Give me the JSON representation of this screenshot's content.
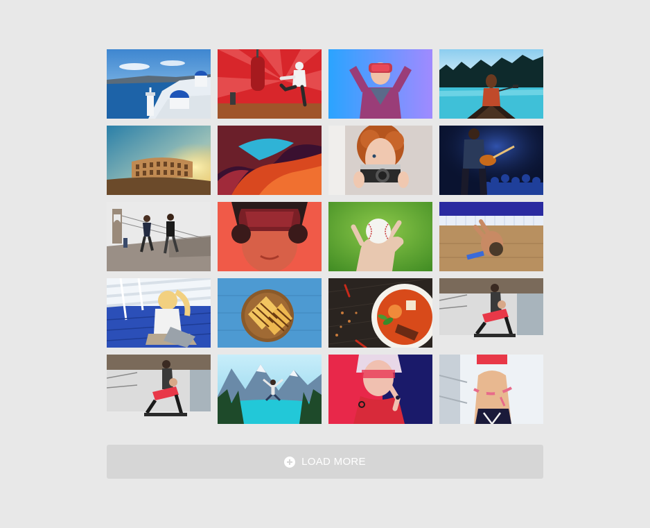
{
  "gallery": {
    "tiles": [
      {
        "subject": "santorini-coast",
        "colors": {
          "sky": "#6fb0e6",
          "sea": "#1d63a8",
          "land": "#e8eef4",
          "accent": "#1e55b8"
        }
      },
      {
        "subject": "boxer-red-room",
        "colors": {
          "bg": "#d8262b",
          "stripe": "#f06a6a",
          "floor": "#a0542a",
          "figure": "#f2f2f2"
        }
      },
      {
        "subject": "woman-vr-headset-blue",
        "colors": {
          "bg": "#3aa8ff",
          "bg2": "#9b7cff",
          "shirt": "#9a3d78",
          "skin": "#f0c2a8"
        }
      },
      {
        "subject": "woman-canoe-lake",
        "colors": {
          "sky": "#a9d9f2",
          "trees": "#0e2a2c",
          "water": "#3fc0d8",
          "boat": "#2b1d16"
        }
      },
      {
        "subject": "colosseum-sunset",
        "colors": {
          "sky": "#3a8fb0",
          "sun": "#ffd36a",
          "ruin": "#c08a52",
          "ground": "#6b4a2a"
        }
      },
      {
        "subject": "antelope-canyon",
        "colors": {
          "rock": "#d9481f",
          "rock2": "#6b1f2a",
          "sky": "#2fb3d6",
          "shadow": "#3a1030"
        }
      },
      {
        "subject": "redhead-camera",
        "colors": {
          "bg": "#d8d0cc",
          "hair": "#b5551e",
          "skin": "#f0c8b0",
          "camera": "#2a2a2a"
        }
      },
      {
        "subject": "guitarist-concert",
        "colors": {
          "bg": "#0a1330",
          "crowd": "#1f3f9a",
          "light": "#4a7cff",
          "guitar": "#c86a1a"
        }
      },
      {
        "subject": "couple-running-bridge",
        "colors": {
          "sky": "#eaeaea",
          "bridge": "#8a8a8a",
          "shirt": "#222a40",
          "road": "#9a8f86"
        }
      },
      {
        "subject": "woman-vr-headset-red",
        "colors": {
          "bg": "#f05a48",
          "headset": "#7a1f26",
          "skin": "#d86048",
          "hair": "#2a1a1a"
        }
      },
      {
        "subject": "hand-holding-baseball",
        "colors": {
          "bg": "#4e9a2a",
          "bg2": "#8cc84a",
          "skin": "#e8c8b0",
          "ball": "#f4f4f0"
        }
      },
      {
        "subject": "boy-at-pool",
        "colors": {
          "water": "#2a2aa0",
          "tile": "#e8eef8",
          "deck": "#b89060",
          "skin": "#c88a64"
        }
      },
      {
        "subject": "woman-laptop-deck",
        "colors": {
          "bg": "#2b4fb8",
          "rail": "#e8eef4",
          "hair": "#f2d080",
          "shirt": "#f2f2f2"
        }
      },
      {
        "subject": "grilled-sandwich",
        "colors": {
          "bg": "#4d9ad2",
          "plate": "#8a5a2a",
          "bread": "#f2c560",
          "grill": "#6a3a12"
        }
      },
      {
        "subject": "curry-soup-bowl",
        "colors": {
          "bg": "#2a2420",
          "bowl": "#f4f2ec",
          "soup": "#d84a1a",
          "herb": "#3a8a2a"
        }
      },
      {
        "subject": "gym-trainer-couple",
        "colors": {
          "bg": "#dcdcdc",
          "floor": "#e8e8e8",
          "top": "#e83848",
          "skin": "#d8a888"
        }
      },
      {
        "subject": "gym-trainer-couple-2",
        "colors": {
          "bg": "#dcdcdc",
          "floor": "#e8e8e8",
          "top": "#e83848",
          "skin": "#d8a888"
        }
      },
      {
        "subject": "mountain-lake-jump",
        "colors": {
          "sky": "#9ad8f0",
          "mountain": "#6a8aa8",
          "lake": "#22c8d8",
          "tree": "#1e4a2a"
        }
      },
      {
        "subject": "woman-red-blue-portrait",
        "colors": {
          "bg": "#e8284a",
          "bg2": "#1a1a6a",
          "hair": "#e8d8e8",
          "skin": "#f0c0b0"
        }
      },
      {
        "subject": "fitness-measuring-tape",
        "colors": {
          "bg": "#eef2f6",
          "skin": "#e8b890",
          "top": "#e83848",
          "pants": "#1a1a3a"
        }
      }
    ]
  },
  "load_more": {
    "label": "LOAD MORE",
    "icon": "plus-circle-icon",
    "bg_color": "#d6d6d6",
    "text_color": "#ffffff"
  }
}
